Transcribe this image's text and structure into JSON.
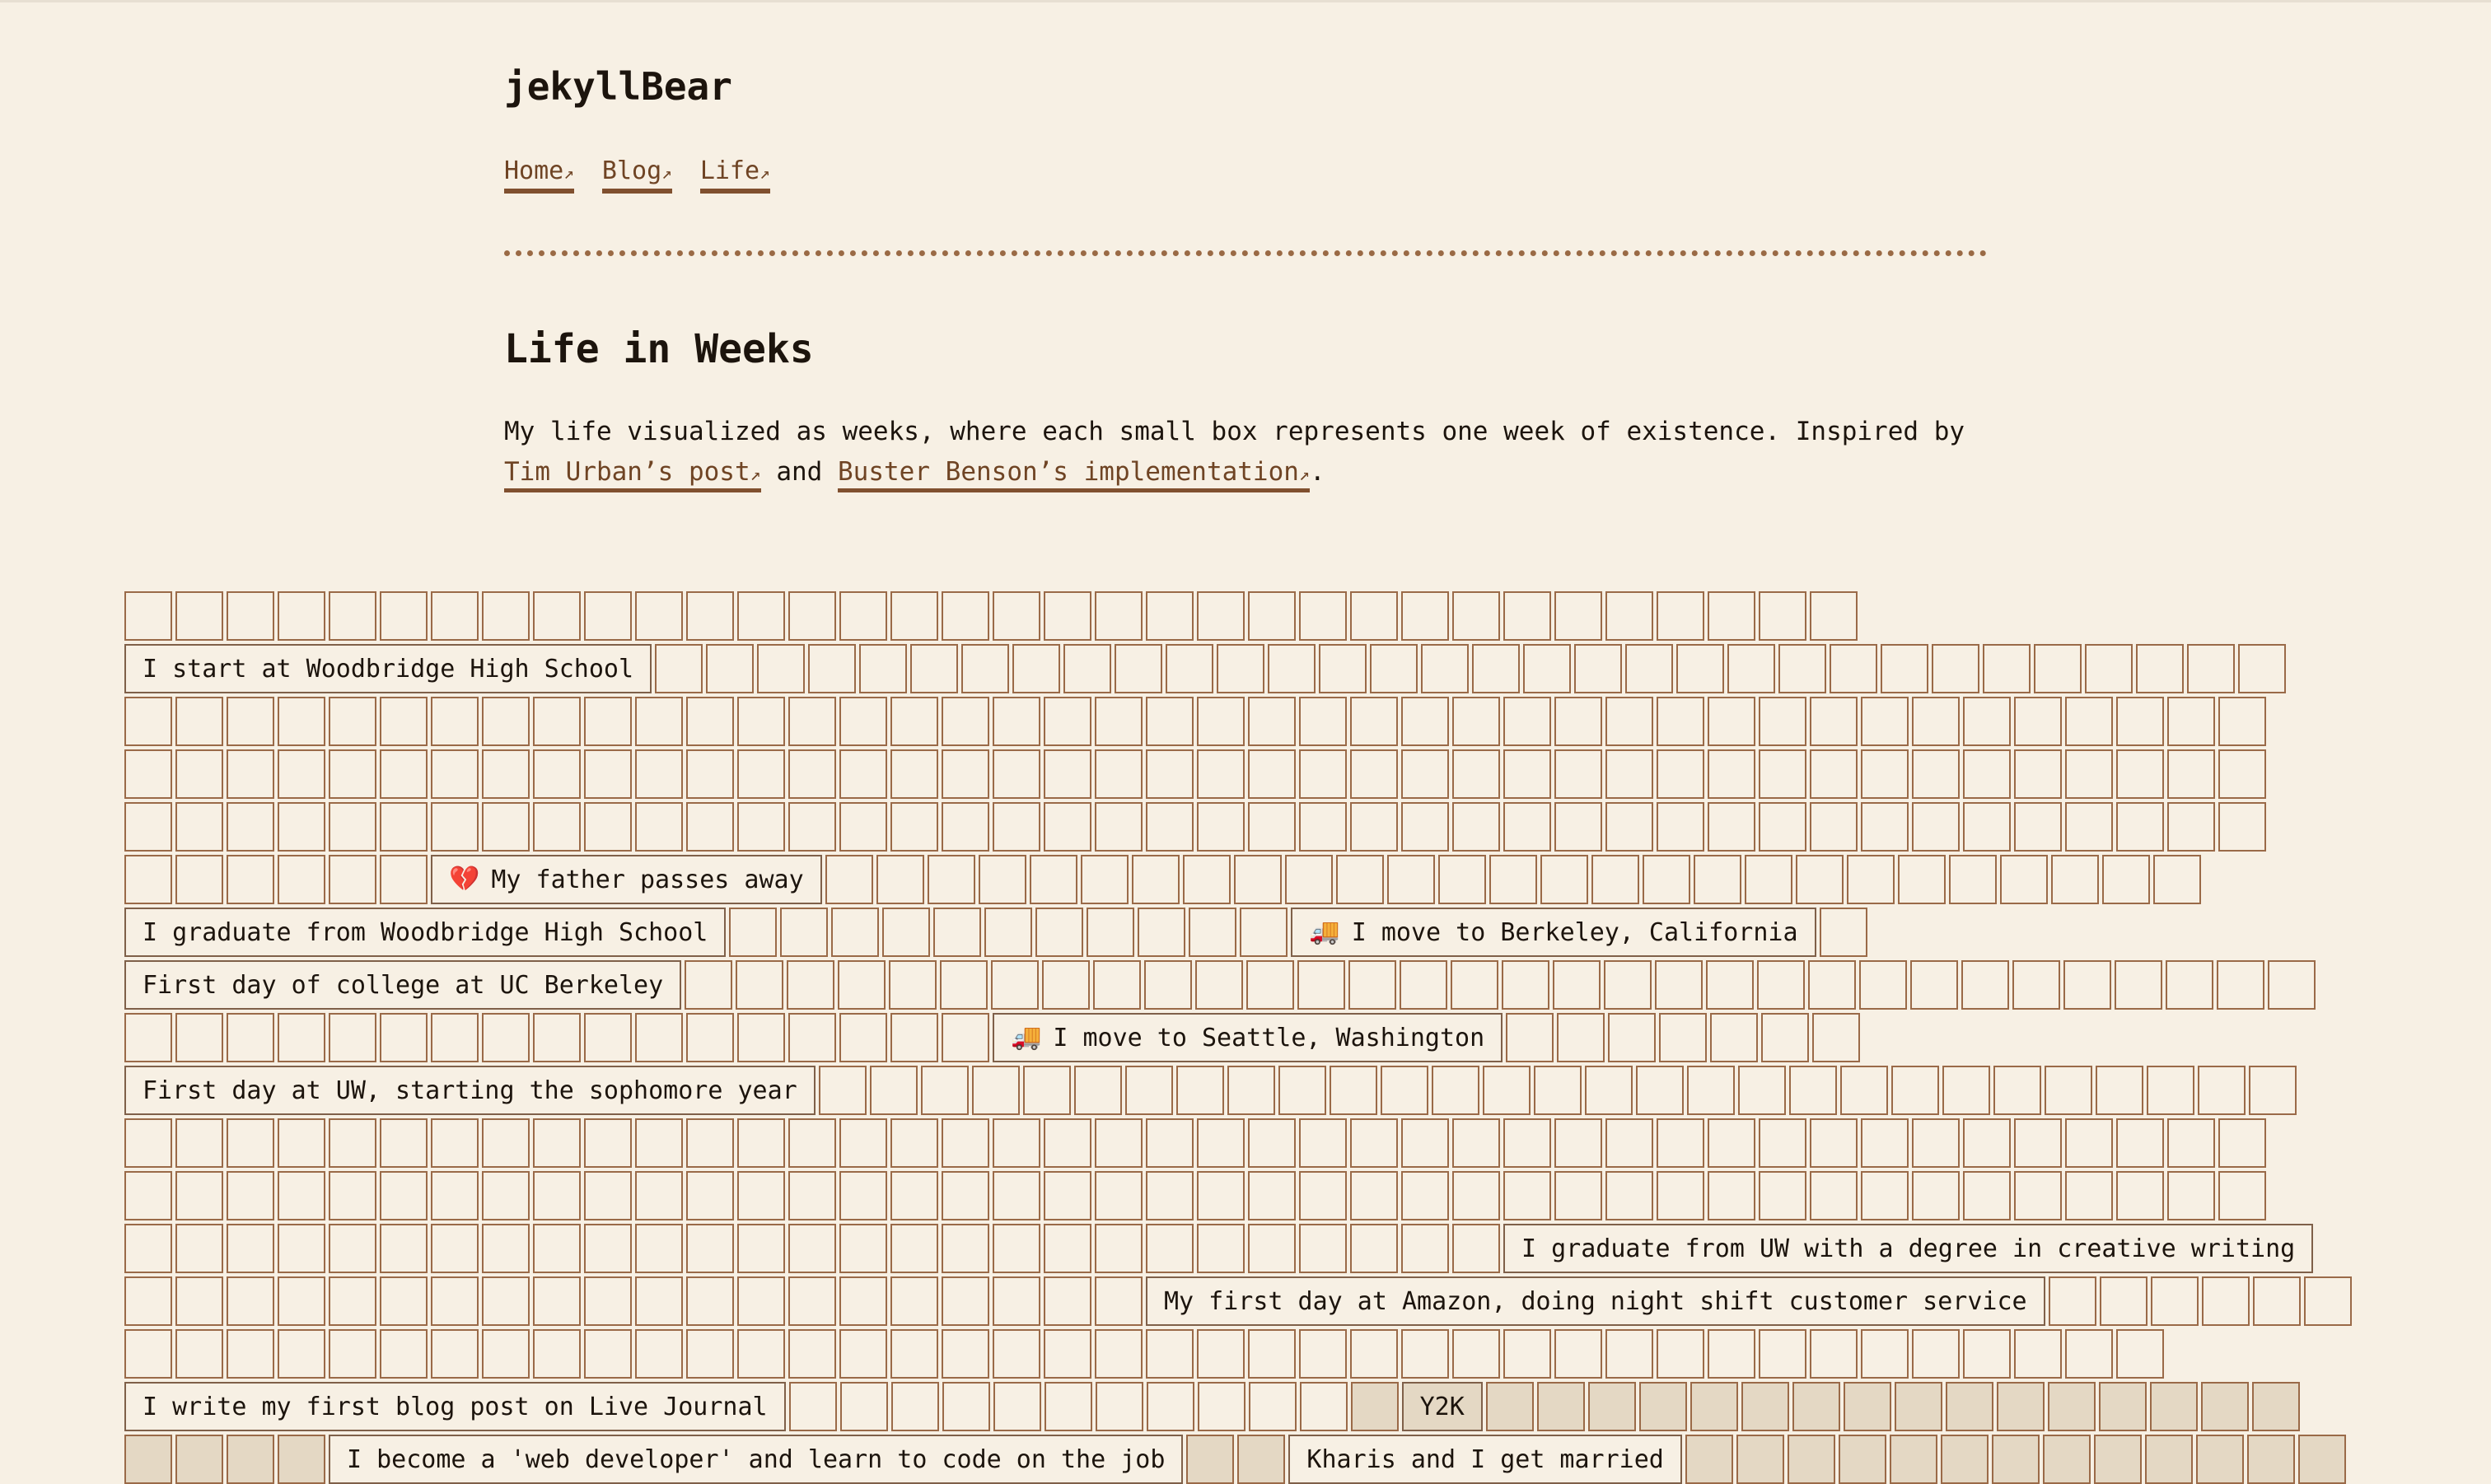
{
  "site": {
    "title": "jekyllBear"
  },
  "nav": [
    {
      "label": "Home",
      "arrow": "↗"
    },
    {
      "label": "Blog",
      "arrow": "↗"
    },
    {
      "label": "Life",
      "arrow": "↗"
    }
  ],
  "page": {
    "title": "Life in Weeks",
    "intro_prefix": "My life visualized as weeks, where each small box represents one week of existence. Inspired by ",
    "link1": "Tim Urban’s post",
    "link1_arrow": "↗",
    "and": " and ",
    "link2": "Buster Benson’s implementation",
    "link2_arrow": "↗",
    "intro_suffix": "."
  },
  "icons": {
    "broken-heart-icon": "💔",
    "moving-truck-icon": "🚚"
  },
  "colors": {
    "background": "#f7f0e4",
    "box_border": "#9a6a48",
    "past_week_fill": "#e4d8c4",
    "link": "#6f4424"
  },
  "timeline": [
    [
      {
        "boxes": 34
      }
    ],
    [
      {
        "label": "I start at Woodbridge High School"
      },
      {
        "boxes": 32
      }
    ],
    [
      {
        "boxes": 42
      }
    ],
    [
      {
        "boxes": 42
      }
    ],
    [
      {
        "boxes": 42
      }
    ],
    [
      {
        "boxes": 6
      },
      {
        "label": "My father passes away",
        "icon": "💔",
        "icon_name": "broken-heart-icon"
      },
      {
        "boxes": 27
      }
    ],
    [
      {
        "label": "I graduate from Woodbridge High School"
      },
      {
        "boxes": 11
      },
      {
        "label": "I move to Berkeley, California",
        "icon": "🚚",
        "icon_name": "moving-truck-icon"
      },
      {
        "boxes": 1
      }
    ],
    [
      {
        "label": "First day of college at UC Berkeley"
      },
      {
        "boxes": 32
      }
    ],
    [
      {
        "boxes": 17
      },
      {
        "label": "I move to Seattle, Washington",
        "icon": "🚚",
        "icon_name": "moving-truck-icon"
      },
      {
        "boxes": 7
      }
    ],
    [
      {
        "label": "First day at UW, starting the sophomore year"
      },
      {
        "boxes": 29
      }
    ],
    [
      {
        "boxes": 42
      }
    ],
    [
      {
        "boxes": 42
      }
    ],
    [
      {
        "boxes": 27
      },
      {
        "label": "I graduate from UW with a degree in creative writing"
      }
    ],
    [
      {
        "boxes": 20
      },
      {
        "label": "My first day at Amazon, doing night shift customer service"
      },
      {
        "boxes": 6
      }
    ],
    [
      {
        "boxes": 40
      }
    ],
    [
      {
        "label": "I write my first blog post on Live Journal"
      },
      {
        "boxes": 11
      },
      {
        "boxes": 1,
        "past": true
      },
      {
        "label": "Y2K",
        "past": true
      },
      {
        "boxes": 16,
        "past": true
      }
    ],
    [
      {
        "boxes": 4,
        "past": true
      },
      {
        "label": "I become a 'web developer' and learn to code on the job"
      },
      {
        "boxes": 2,
        "past": true
      },
      {
        "label": "Kharis and I get married"
      },
      {
        "boxes": 13,
        "past": true
      }
    ]
  ]
}
